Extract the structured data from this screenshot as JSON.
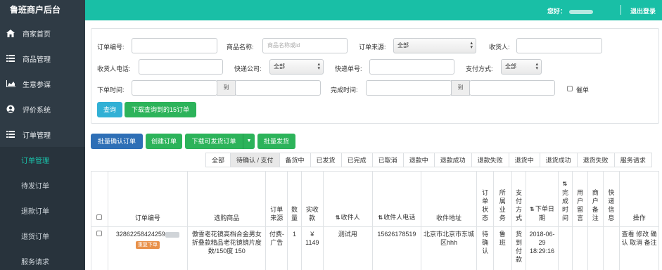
{
  "brand": "鲁班商户后台",
  "header": {
    "greeting": "您好：",
    "logout": "退出登录"
  },
  "sidebar": {
    "items": [
      {
        "label": "商家首页",
        "icon": "home-icon"
      },
      {
        "label": "商品管理",
        "icon": "list-icon"
      },
      {
        "label": "生意参谋",
        "icon": "area-chart-icon"
      },
      {
        "label": "评价系统",
        "icon": "user-circle-icon"
      },
      {
        "label": "订单管理",
        "icon": "list-icon"
      }
    ],
    "subitems": [
      "订单管理",
      "待发订单",
      "退款订单",
      "退货订单",
      "服务请求"
    ]
  },
  "filter": {
    "order_no": "订单编号:",
    "product_name": "商品名称:",
    "product_placeholder": "商品名称或id",
    "order_source": "订单来源:",
    "order_source_value": "全部",
    "receiver": "收货人:",
    "receiver_phone": "收货人电话:",
    "courier": "快递公司:",
    "courier_value": "全部",
    "tracking_no": "快递单号:",
    "payment": "支付方式:",
    "payment_value": "全部",
    "order_time": "下单时间:",
    "to": "到",
    "finish_time": "完成时间:",
    "urge": "催单",
    "query": "查询",
    "download_query": "下载查询到的15订单"
  },
  "actions": {
    "batch_confirm": "批量确认订单",
    "create": "创建订单",
    "download_shippable": "下载可发货订单",
    "batch_ship": "批量发货"
  },
  "tabs": [
    "全部",
    "待确认 / 支付",
    "备货中",
    "已发货",
    "已完成",
    "已取消",
    "退款中",
    "退款成功",
    "退款失败",
    "退货中",
    "退货成功",
    "退货失败",
    "服务请求"
  ],
  "table": {
    "headers": {
      "order_no": "订单编号",
      "product": "选购商品",
      "source": "订单来源",
      "qty": "数量",
      "paid": "实收款",
      "receiver": "收件人",
      "phone": "收件人电话",
      "address": "收件地址",
      "status": "订单状态",
      "business": "所属业务",
      "pay_method": "支付方式",
      "order_date": "下单日期",
      "finish_time": "完成时间",
      "user_msg": "用户留言",
      "merchant_note": "商户备注",
      "express_info": "快递信息",
      "ops": "操作"
    },
    "rows": [
      {
        "order_no": "32862258424259",
        "badge": "重复下单",
        "product": "傲雪老花镜高档合金男女折叠款精品老花镜镜片度数/150度 150",
        "source": "付费-广告",
        "qty": "1",
        "paid": "¥ 1149",
        "receiver": "测试用",
        "phone": "15626178519",
        "address": "北京市北京市东城区hhh",
        "status": "待确认",
        "business": "鲁班",
        "pay_method": "货到付款",
        "order_date": "2018-06-29 18:29:16",
        "ops": "查看 修改 确认 取消 备注"
      }
    ]
  }
}
